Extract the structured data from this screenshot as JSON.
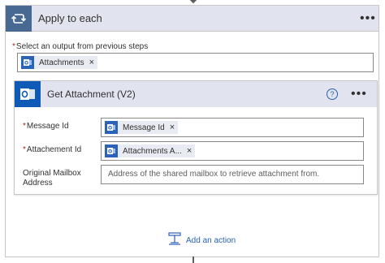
{
  "loop": {
    "title": "Apply to each",
    "more_label": "•••",
    "select_label": "Select an output from previous steps",
    "select_token": "Attachments",
    "icon": "loop-icon"
  },
  "action": {
    "title": "Get Attachment (V2)",
    "help_label": "?",
    "more_label": "•••",
    "icon": "outlook-icon",
    "fields": {
      "message_id_label": "Message Id",
      "message_id_token": "Message Id",
      "attachment_id_label": "Attachement Id",
      "attachment_id_token": "Attachments A...",
      "mailbox_label_line1": "Original Mailbox",
      "mailbox_label_line2": "Address",
      "mailbox_placeholder": "Address of the shared mailbox to retrieve attachment from."
    }
  },
  "add_action": {
    "label": "Add an action",
    "icon": "add-action-icon"
  },
  "token_close": "×",
  "required_mark": "*",
  "colors": {
    "header_bg": "#e1e3ef",
    "loop_icon_bg": "#486991",
    "outlook_blue": "#0f5ab6",
    "link_blue": "#2b5fb3",
    "required_red": "#a4262c"
  }
}
